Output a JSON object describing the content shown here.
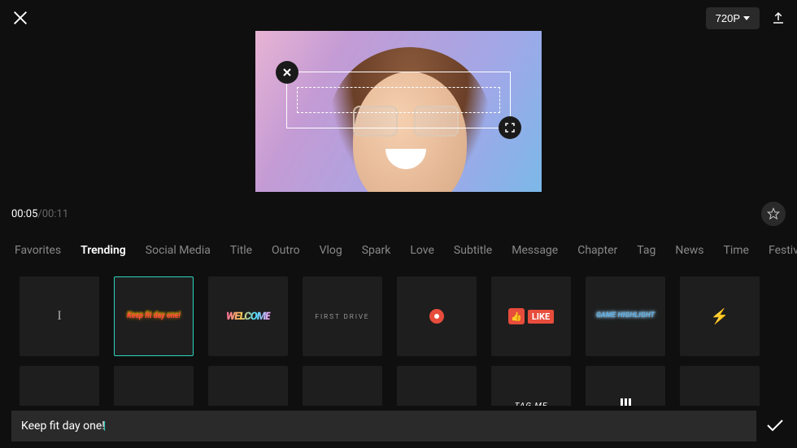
{
  "topbar": {
    "resolution_label": "720P"
  },
  "time": {
    "current": "00:05",
    "separator": " / ",
    "total": "00:11"
  },
  "categories": [
    {
      "id": "favorites",
      "label": "Favorites",
      "active": false
    },
    {
      "id": "trending",
      "label": "Trending",
      "active": true
    },
    {
      "id": "social-media",
      "label": "Social Media",
      "active": false
    },
    {
      "id": "title",
      "label": "Title",
      "active": false
    },
    {
      "id": "outro",
      "label": "Outro",
      "active": false
    },
    {
      "id": "vlog",
      "label": "Vlog",
      "active": false
    },
    {
      "id": "spark",
      "label": "Spark",
      "active": false
    },
    {
      "id": "love",
      "label": "Love",
      "active": false
    },
    {
      "id": "subtitle",
      "label": "Subtitle",
      "active": false
    },
    {
      "id": "message",
      "label": "Message",
      "active": false
    },
    {
      "id": "chapter",
      "label": "Chapter",
      "active": false
    },
    {
      "id": "tag",
      "label": "Tag",
      "active": false
    },
    {
      "id": "news",
      "label": "News",
      "active": false
    },
    {
      "id": "time",
      "label": "Time",
      "active": false
    },
    {
      "id": "festival",
      "label": "Festival",
      "active": false
    }
  ],
  "templates_row1": [
    {
      "id": "plain-cursor",
      "text": "I"
    },
    {
      "id": "keep-fit",
      "text": "Keep fit day one!",
      "selected": true
    },
    {
      "id": "welcome",
      "text": "WELCOME"
    },
    {
      "id": "first-drive",
      "text": "FIRST DRIVE"
    },
    {
      "id": "record-dot",
      "text": ""
    },
    {
      "id": "like",
      "text": "LIKE"
    },
    {
      "id": "game-highlight",
      "text": "GAME HIGHLIGHT"
    },
    {
      "id": "bolt",
      "text": ""
    }
  ],
  "templates_row2": [
    {
      "id": "r2a",
      "text": ""
    },
    {
      "id": "r2b",
      "text": ""
    },
    {
      "id": "r2c",
      "text": ""
    },
    {
      "id": "r2d",
      "text": ""
    },
    {
      "id": "r2e",
      "text": ""
    },
    {
      "id": "tag-me",
      "text": "TAG ME"
    },
    {
      "id": "stripes",
      "text": ""
    },
    {
      "id": "r2h",
      "text": ""
    }
  ],
  "input": {
    "text": "Keep fit day one!"
  }
}
